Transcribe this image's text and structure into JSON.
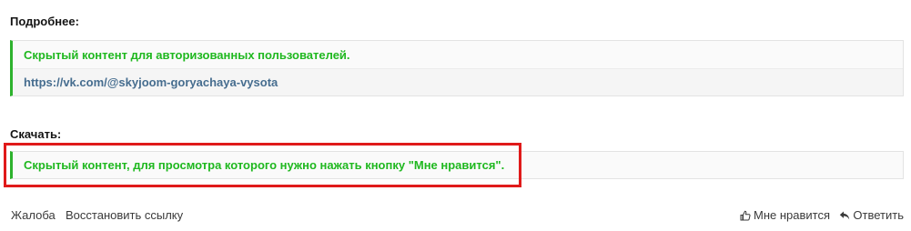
{
  "details": {
    "title": "Подробнее:",
    "hidden_notice": "Скрытый контент для авторизованных пользователей.",
    "link": "https://vk.com/@skyjoom-goryachaya-vysota"
  },
  "download": {
    "title": "Скачать:",
    "hidden_notice": "Скрытый контент, для просмотра которого нужно нажать кнопку \"Мне нравится\"."
  },
  "footer": {
    "report_label": "Жалоба",
    "restore_label": "Восстановить ссылку",
    "like_label": "Мне нравится",
    "like_icon": "thumbs-up-icon",
    "reply_label": "Ответить",
    "reply_icon": "reply-arrow-icon"
  },
  "colors": {
    "hidden_text": "#1fb81f",
    "link": "#466d8f",
    "quote_border": "#2db22d",
    "highlight": "#e01a1a"
  }
}
